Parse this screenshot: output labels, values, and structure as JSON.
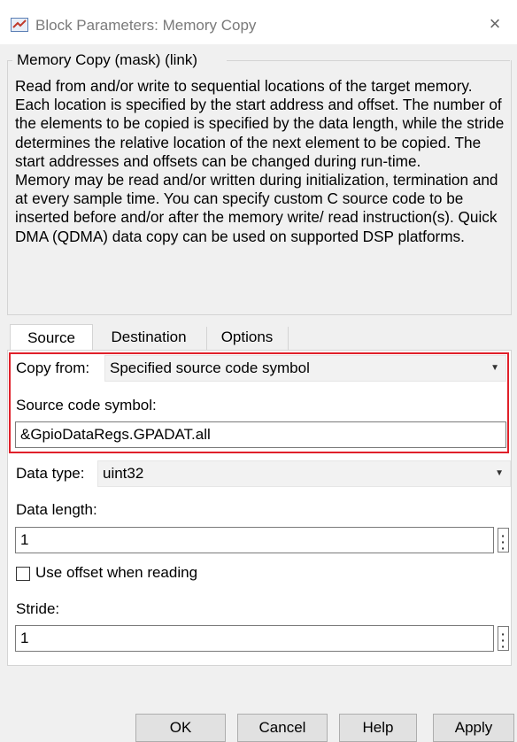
{
  "window": {
    "title": "Block Parameters: Memory Copy",
    "close_glyph": "×"
  },
  "mask": {
    "title": "Memory Copy (mask) (link)",
    "description": "Read from and/or write to sequential locations of the target memory. Each location is specified by the start address and offset. The number of the elements to be copied is specified by the data length, while the stride determines the relative location of the next element to be copied. The start addresses and offsets can be changed during run-time.\nMemory may be read and/or written during initialization, termination and at every sample time. You can specify custom C source code to be inserted before and/or after the memory write/ read instruction(s). Quick DMA (QDMA) data copy can be used on supported DSP platforms."
  },
  "tabs": [
    {
      "label": "Source",
      "active": true
    },
    {
      "label": "Destination",
      "active": false
    },
    {
      "label": "Options",
      "active": false
    }
  ],
  "source": {
    "copy_from_label": "Copy from:",
    "copy_from_value": "Specified source code symbol",
    "symbol_label": "Source code symbol:",
    "symbol_value": "&GpioDataRegs.GPADAT.all",
    "data_type_label": "Data type:",
    "data_type_value": "uint32",
    "data_length_label": "Data length:",
    "data_length_value": "1",
    "offset_label": "Use offset when reading",
    "offset_checked": false,
    "stride_label": "Stride:",
    "stride_value": "1"
  },
  "buttons": {
    "ok": "OK",
    "cancel": "Cancel",
    "help": "Help",
    "apply": "Apply"
  },
  "colors": {
    "highlight": "#e0202a",
    "dialog_bg": "#f0f0f0",
    "panel_bg": "#ffffff"
  },
  "icons": {
    "title": "simulink-block-icon",
    "close": "close-icon",
    "dropdown": "chevron-down-icon",
    "dots": "vertical-ellipsis-icon"
  }
}
